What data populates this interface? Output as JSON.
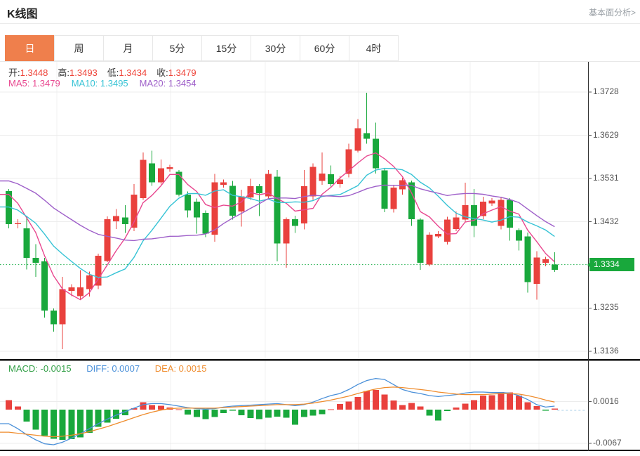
{
  "header": {
    "title": "K线图",
    "analysis_link": "基本面分析>"
  },
  "tabs": {
    "active": "日",
    "items": [
      "日",
      "周",
      "月",
      "5分",
      "15分",
      "30分",
      "60分",
      "4时"
    ]
  },
  "ohlc_legend": [
    {
      "label": "开:",
      "value": "1.3448"
    },
    {
      "label": "高:",
      "value": "1.3493"
    },
    {
      "label": "低:",
      "value": "1.3434"
    },
    {
      "label": "收:",
      "value": "1.3479"
    }
  ],
  "ma_legend": [
    {
      "text": "MA5: 1.3479",
      "color": "#e8478f"
    },
    {
      "text": "MA10: 1.3495",
      "color": "#36c3d5"
    },
    {
      "text": "MA20: 1.3454",
      "color": "#9e5fc9"
    }
  ],
  "colors": {
    "up": "#e9413d",
    "down": "#19a83c",
    "current_line": "#2eb558",
    "grid": "#ececec",
    "vgrid": "#f2f2f2",
    "axis_line": "#333333",
    "tab_active_bg": "#ef7f4c",
    "value_red": "#ee4237",
    "separator": "#141414",
    "macd_ext_dash": "#a8cfe8"
  },
  "chart_data": {
    "type": "candlestick+macd",
    "title": "K线图",
    "price_axis": {
      "ticks": [
        1.3728,
        1.3629,
        1.3531,
        1.3432,
        1.3235,
        1.3136
      ],
      "current": "1.3334",
      "current_value": 1.3334
    },
    "candles": {
      "open": [
        1.3502,
        1.3426,
        1.3417,
        1.3349,
        1.3341,
        1.3229,
        1.3198,
        1.3274,
        1.3262,
        1.3278,
        1.3286,
        1.3342,
        1.3433,
        1.3442,
        1.3418,
        1.3486,
        1.3565,
        1.3522,
        1.3552,
        1.3546,
        1.3494,
        1.3478,
        1.3452,
        1.3402,
        1.3516,
        1.3514,
        1.3455,
        1.3487,
        1.3513,
        1.349,
        1.3535,
        1.3382,
        1.3438,
        1.3428,
        1.349,
        1.3525,
        1.354,
        1.3518,
        1.3541,
        1.3594,
        1.3634,
        1.3621,
        1.3549,
        1.3461,
        1.3506,
        1.3522,
        1.3437,
        1.3334,
        1.3398,
        1.3386,
        1.3415,
        1.3437,
        1.347,
        1.3445,
        1.3474,
        1.3422,
        1.3482,
        1.3413,
        1.3398,
        1.329,
        1.3338,
        1.3334
      ],
      "close": [
        1.3426,
        1.3429,
        1.3349,
        1.3338,
        1.3229,
        1.3198,
        1.3278,
        1.3282,
        1.3282,
        1.3309,
        1.3354,
        1.3438,
        1.3445,
        1.3426,
        1.3494,
        1.3573,
        1.3522,
        1.3554,
        1.3556,
        1.3494,
        1.3458,
        1.3442,
        1.3405,
        1.3522,
        1.3522,
        1.3446,
        1.349,
        1.3513,
        1.3497,
        1.3541,
        1.3382,
        1.3438,
        1.3422,
        1.3513,
        1.3557,
        1.3542,
        1.3518,
        1.3528,
        1.3597,
        1.3645,
        1.3621,
        1.3554,
        1.3462,
        1.351,
        1.3527,
        1.3438,
        1.3338,
        1.3402,
        1.3404,
        1.3437,
        1.3442,
        1.347,
        1.3422,
        1.3478,
        1.348,
        1.3482,
        1.3418,
        1.3389,
        1.3294,
        1.335,
        1.3346,
        1.3322
      ],
      "high": [
        1.3507,
        1.3438,
        1.3446,
        1.3381,
        1.3349,
        1.3234,
        1.3306,
        1.3289,
        1.3321,
        1.3318,
        1.3359,
        1.3444,
        1.3461,
        1.347,
        1.3518,
        1.359,
        1.3594,
        1.3574,
        1.3562,
        1.355,
        1.3501,
        1.3485,
        1.3458,
        1.3541,
        1.3528,
        1.3525,
        1.3505,
        1.353,
        1.3518,
        1.355,
        1.355,
        1.3442,
        1.3446,
        1.355,
        1.3565,
        1.359,
        1.356,
        1.3536,
        1.361,
        1.3666,
        1.3726,
        1.3658,
        1.3554,
        1.3516,
        1.3532,
        1.3526,
        1.344,
        1.3408,
        1.341,
        1.3443,
        1.3455,
        1.3521,
        1.3507,
        1.3489,
        1.3486,
        1.3489,
        1.3486,
        1.3417,
        1.3407,
        1.3365,
        1.3352,
        1.3362
      ],
      "low": [
        1.3417,
        1.3417,
        1.3323,
        1.3306,
        1.3213,
        1.3181,
        1.3141,
        1.3262,
        1.3253,
        1.3261,
        1.3278,
        1.334,
        1.3415,
        1.3406,
        1.341,
        1.3482,
        1.3514,
        1.3517,
        1.3546,
        1.349,
        1.3442,
        1.3405,
        1.3397,
        1.3386,
        1.351,
        1.3437,
        1.3421,
        1.3482,
        1.3445,
        1.3485,
        1.3341,
        1.3327,
        1.3406,
        1.3414,
        1.3482,
        1.3516,
        1.3512,
        1.351,
        1.3533,
        1.359,
        1.361,
        1.3542,
        1.3454,
        1.3453,
        1.3494,
        1.3422,
        1.3322,
        1.333,
        1.3394,
        1.338,
        1.341,
        1.3432,
        1.3397,
        1.3438,
        1.3468,
        1.3414,
        1.3389,
        1.3366,
        1.327,
        1.3254,
        1.333,
        1.3317
      ]
    },
    "ma_seeds": {
      "ma5": [
        1.353,
        1.3515,
        1.3505,
        1.3495
      ],
      "ma10": [
        1.35,
        1.3495,
        1.349,
        1.348,
        1.347,
        1.346,
        1.345,
        1.3445,
        1.344
      ],
      "ma20": [
        1.356,
        1.3558,
        1.3555,
        1.3552,
        1.355,
        1.3548,
        1.3545,
        1.3542,
        1.354,
        1.3535,
        1.353,
        1.3525,
        1.352,
        1.3515,
        1.351,
        1.3505,
        1.35,
        1.3495,
        1.349
      ]
    },
    "macd": {
      "legend": [
        {
          "text": "MACD: -0.0015",
          "color": "#2f9e44"
        },
        {
          "text": "DIFF: 0.0007",
          "color": "#4a90d9"
        },
        {
          "text": "DEA: 0.0015",
          "color": "#ef8c2d"
        }
      ],
      "axis_ticks": [
        0.0016,
        -0.0067
      ],
      "hist": [
        0.0019,
        0.0006,
        -0.0024,
        -0.004,
        -0.0052,
        -0.0058,
        -0.006,
        -0.0059,
        -0.0055,
        -0.0046,
        -0.0034,
        -0.0026,
        -0.0018,
        -0.0011,
        0.0003,
        0.0015,
        0.0009,
        0.0008,
        0.0004,
        0.0001,
        -0.001,
        -0.0015,
        -0.0019,
        -0.0015,
        -0.0007,
        -0.0002,
        -0.0011,
        -0.0017,
        -0.0019,
        -0.0016,
        -0.0014,
        -0.0016,
        -0.003,
        -0.0015,
        -0.0012,
        -0.0009,
        0.0001,
        0.0011,
        0.0016,
        0.0025,
        0.0037,
        0.0039,
        0.003,
        0.0018,
        0.0009,
        0.0013,
        0.0006,
        -0.0012,
        -0.0022,
        -0.0003,
        0.0004,
        0.0012,
        0.0019,
        0.0028,
        0.0029,
        0.0035,
        0.0034,
        0.0028,
        0.0015,
        0.0007,
        -0.0002,
        0.0002
      ],
      "diff": [
        -0.0028,
        -0.0038,
        -0.005,
        -0.006,
        -0.0068,
        -0.007,
        -0.0065,
        -0.0057,
        -0.0048,
        -0.0038,
        -0.0028,
        -0.0019,
        -0.0011,
        -0.0004,
        0.0003,
        0.001,
        0.0012,
        0.0012,
        0.001,
        0.0007,
        0.0004,
        0.0002,
        0.0001,
        0.0002,
        0.0005,
        0.0007,
        0.0008,
        0.0009,
        0.001,
        0.0011,
        0.0012,
        0.001,
        0.0008,
        0.001,
        0.0015,
        0.0022,
        0.0028,
        0.0032,
        0.004,
        0.005,
        0.0058,
        0.0062,
        0.006,
        0.005,
        0.004,
        0.0035,
        0.0032,
        0.0028,
        0.0026,
        0.0028,
        0.003,
        0.0033,
        0.0035,
        0.0035,
        0.0034,
        0.0034,
        0.0033,
        0.0028,
        0.002,
        0.001,
        0.0005,
        0.0007
      ],
      "dea": [
        -0.0045,
        -0.0047,
        -0.0049,
        -0.0051,
        -0.0053,
        -0.0054,
        -0.0053,
        -0.0051,
        -0.0048,
        -0.0044,
        -0.0039,
        -0.0034,
        -0.0028,
        -0.0022,
        -0.0016,
        -0.001,
        -0.0005,
        -0.0001,
        0.0002,
        0.0003,
        0.0003,
        0.0003,
        0.0003,
        0.0003,
        0.0004,
        0.0005,
        0.0006,
        0.0007,
        0.0008,
        0.0009,
        0.001,
        0.001,
        0.001,
        0.0011,
        0.0013,
        0.0016,
        0.0019,
        0.0023,
        0.0027,
        0.0032,
        0.0037,
        0.0041,
        0.0044,
        0.0045,
        0.0044,
        0.0042,
        0.004,
        0.0038,
        0.0035,
        0.0033,
        0.0031,
        0.003,
        0.003,
        0.003,
        0.0031,
        0.0032,
        0.0032,
        0.0031,
        0.0028,
        0.0024,
        0.0019,
        0.0015
      ]
    }
  }
}
